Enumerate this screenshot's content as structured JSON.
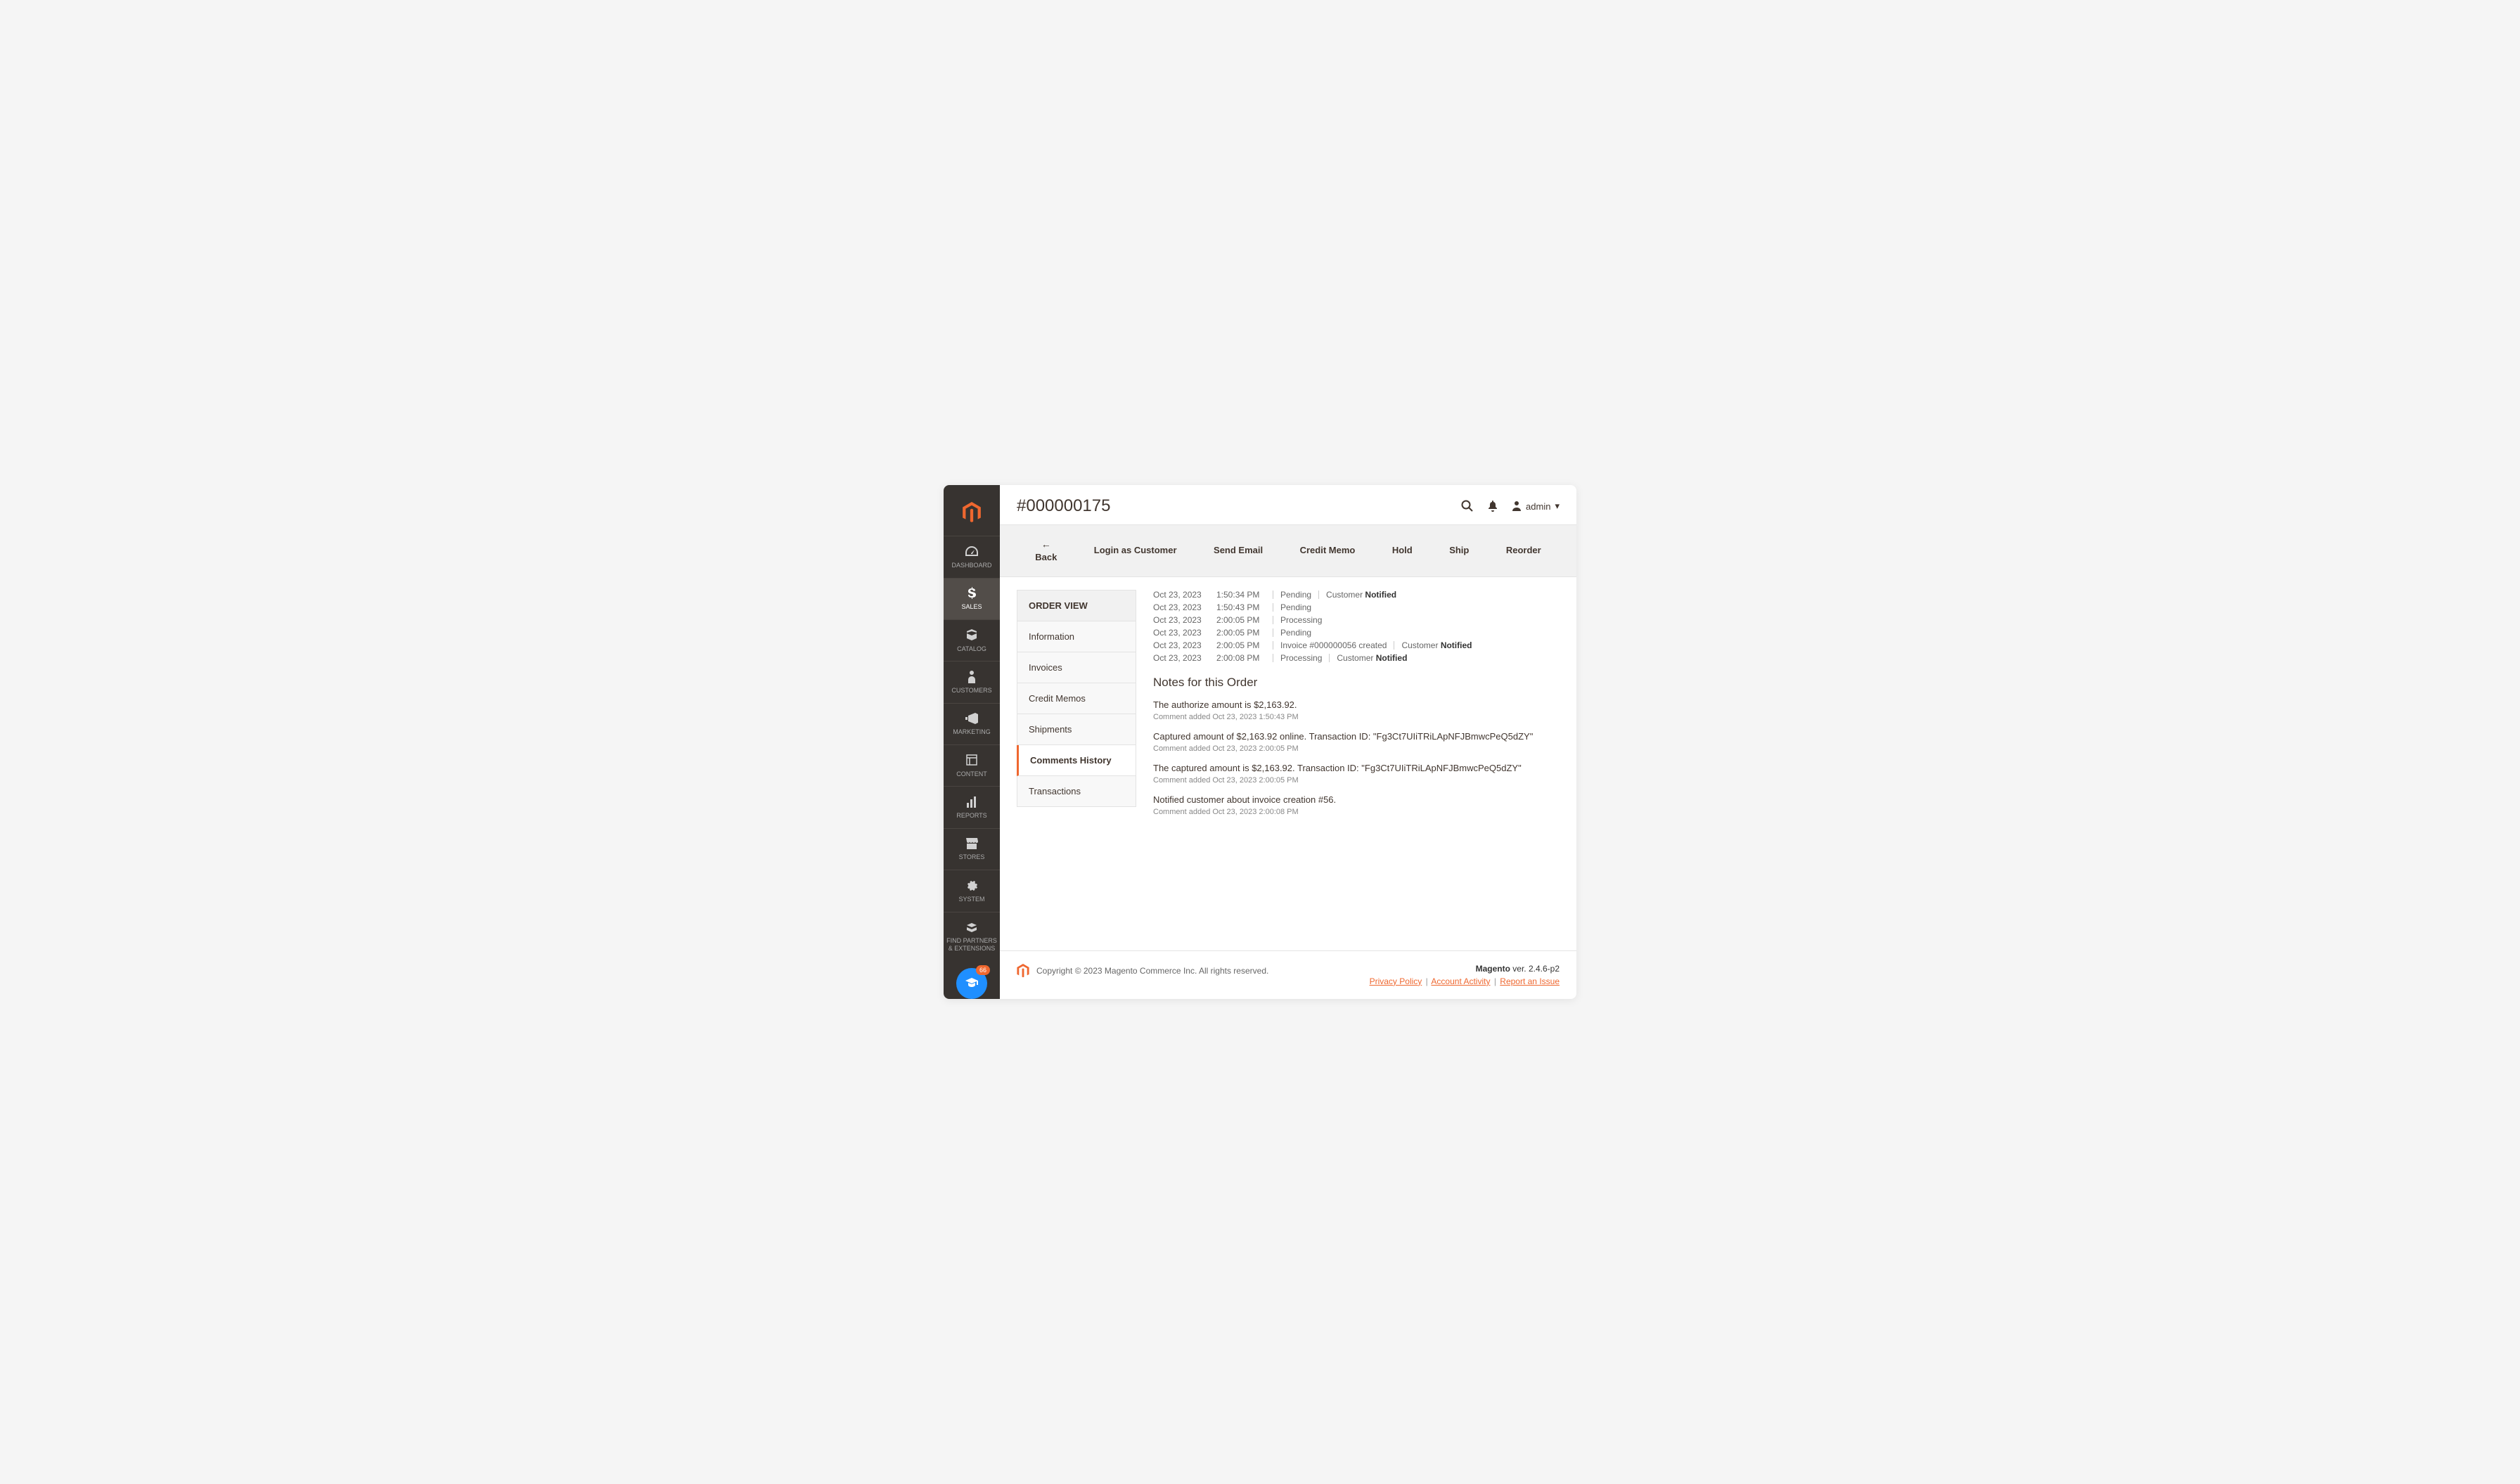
{
  "header": {
    "title": "#000000175",
    "user": "admin"
  },
  "sidebar": {
    "items": [
      {
        "label": "DASHBOARD",
        "icon": "dashboard"
      },
      {
        "label": "SALES",
        "icon": "sales",
        "active": true
      },
      {
        "label": "CATALOG",
        "icon": "catalog"
      },
      {
        "label": "CUSTOMERS",
        "icon": "customers"
      },
      {
        "label": "MARKETING",
        "icon": "marketing"
      },
      {
        "label": "CONTENT",
        "icon": "content"
      },
      {
        "label": "REPORTS",
        "icon": "reports"
      },
      {
        "label": "STORES",
        "icon": "stores"
      },
      {
        "label": "SYSTEM",
        "icon": "system"
      },
      {
        "label": "FIND PARTNERS & EXTENSIONS",
        "icon": "partners"
      }
    ],
    "help_badge": "66"
  },
  "toolbar": {
    "back": "Back",
    "login_as": "Login as Customer",
    "send_email": "Send Email",
    "credit_memo": "Credit Memo",
    "hold": "Hold",
    "ship": "Ship",
    "reorder": "Reorder"
  },
  "panel": {
    "title": "ORDER VIEW",
    "tabs": [
      {
        "label": "Information"
      },
      {
        "label": "Invoices"
      },
      {
        "label": "Credit Memos"
      },
      {
        "label": "Shipments"
      },
      {
        "label": "Comments History",
        "active": true
      },
      {
        "label": "Transactions"
      }
    ]
  },
  "history": [
    {
      "date": "Oct 23, 2023",
      "time": "1:50:34 PM",
      "status": "Pending",
      "extra": "Customer ",
      "extra_bold": "Notified"
    },
    {
      "date": "Oct 23, 2023",
      "time": "1:50:43 PM",
      "status": "Pending"
    },
    {
      "date": "Oct 23, 2023",
      "time": "2:00:05 PM",
      "status": "Processing"
    },
    {
      "date": "Oct 23, 2023",
      "time": "2:00:05 PM",
      "status": "Pending"
    },
    {
      "date": "Oct 23, 2023",
      "time": "2:00:05 PM",
      "status": "Invoice #000000056 created",
      "extra": "Customer ",
      "extra_bold": "Notified"
    },
    {
      "date": "Oct 23, 2023",
      "time": "2:00:08 PM",
      "status": "Processing",
      "extra": "Customer ",
      "extra_bold": "Notified"
    }
  ],
  "notes": {
    "title": "Notes for this Order",
    "items": [
      {
        "text": "The authorize amount is $2,163.92.",
        "meta": "Comment added Oct 23, 2023 1:50:43 PM"
      },
      {
        "text": "Captured amount of $2,163.92 online. Transaction ID: \"Fg3Ct7UIiTRiLApNFJBmwcPeQ5dZY\"",
        "meta": "Comment added Oct 23, 2023 2:00:05 PM"
      },
      {
        "text": "The captured amount is $2,163.92. Transaction ID: \"Fg3Ct7UIiTRiLApNFJBmwcPeQ5dZY\"",
        "meta": "Comment added Oct 23, 2023 2:00:05 PM"
      },
      {
        "text": "Notified customer about invoice creation #56.",
        "meta": "Comment added Oct 23, 2023 2:00:08 PM"
      }
    ]
  },
  "footer": {
    "copyright": "Copyright © 2023 Magento Commerce Inc. All rights reserved.",
    "brand": "Magento",
    "version": " ver. 2.4.6-p2",
    "privacy": "Privacy Policy",
    "activity": " Account Activity",
    "report": "Report an Issue"
  }
}
